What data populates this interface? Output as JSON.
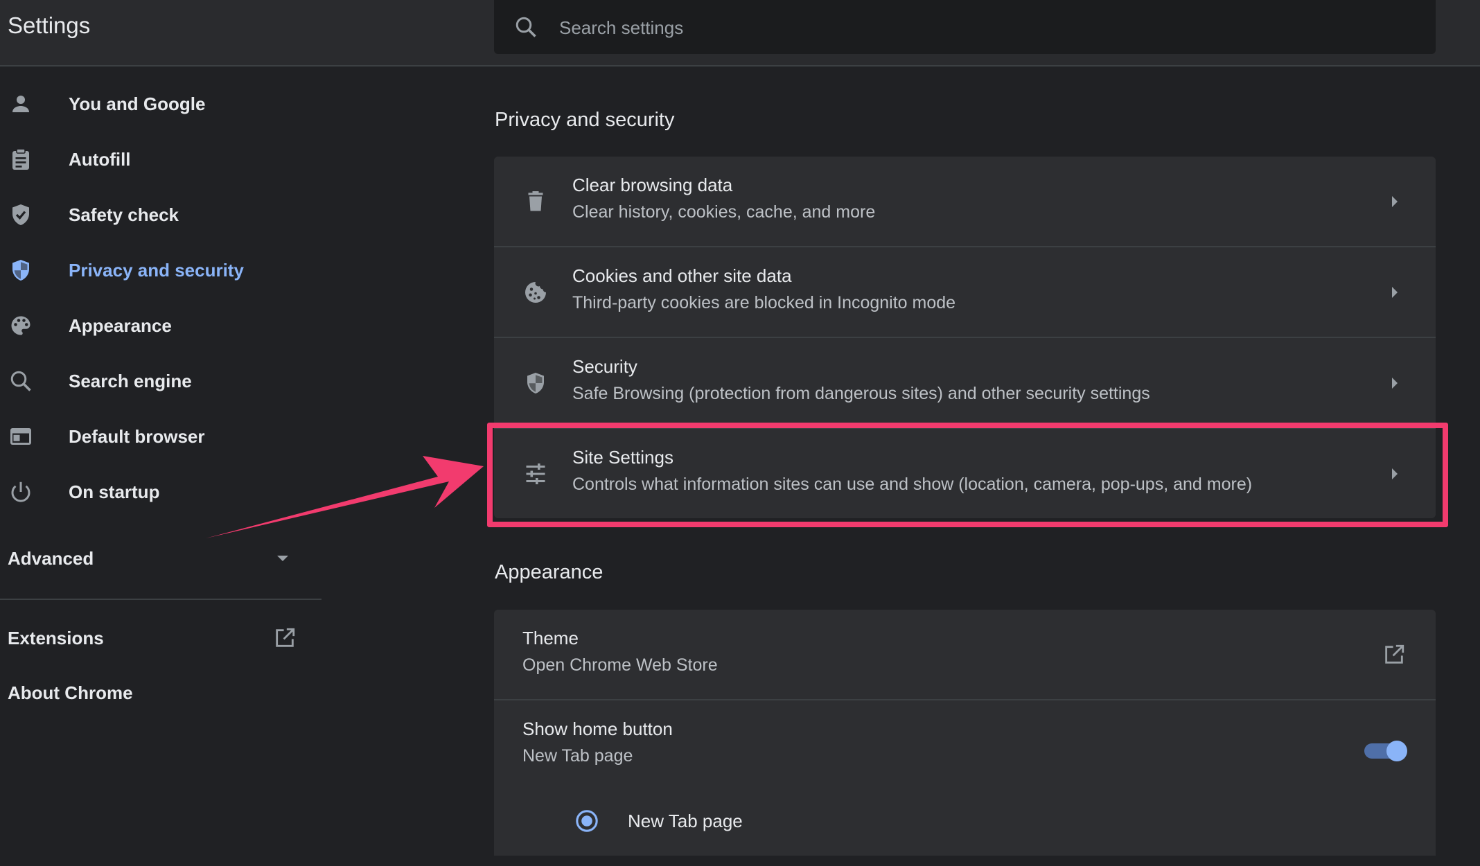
{
  "app": {
    "title": "Settings"
  },
  "search": {
    "placeholder": "Search settings"
  },
  "sidebar": {
    "items": [
      {
        "label": "You and Google",
        "icon": "person-icon"
      },
      {
        "label": "Autofill",
        "icon": "clipboard-icon"
      },
      {
        "label": "Safety check",
        "icon": "shield-check-icon"
      },
      {
        "label": "Privacy and security",
        "icon": "shield-icon",
        "active": true
      },
      {
        "label": "Appearance",
        "icon": "palette-icon"
      },
      {
        "label": "Search engine",
        "icon": "search-icon"
      },
      {
        "label": "Default browser",
        "icon": "browser-icon"
      },
      {
        "label": "On startup",
        "icon": "power-icon"
      }
    ],
    "advanced_label": "Advanced",
    "extensions_label": "Extensions",
    "about_label": "About Chrome"
  },
  "privacy": {
    "title": "Privacy and security",
    "rows": [
      {
        "title": "Clear browsing data",
        "subtitle": "Clear history, cookies, cache, and more",
        "icon": "trash-icon"
      },
      {
        "title": "Cookies and other site data",
        "subtitle": "Third-party cookies are blocked in Incognito mode",
        "icon": "cookie-icon"
      },
      {
        "title": "Security",
        "subtitle": "Safe Browsing (protection from dangerous sites) and other security settings",
        "icon": "security-shield-icon"
      },
      {
        "title": "Site Settings",
        "subtitle": "Controls what information sites can use and show (location, camera, pop-ups, and more)",
        "icon": "tune-icon"
      }
    ]
  },
  "appearance": {
    "title": "Appearance",
    "theme": {
      "title": "Theme",
      "subtitle": "Open Chrome Web Store"
    },
    "home_button": {
      "title": "Show home button",
      "subtitle": "New Tab page",
      "enabled": true
    },
    "radio_option": {
      "label": "New Tab page",
      "selected": true
    }
  },
  "colors": {
    "background": "#202124",
    "accent": "#8ab4f8",
    "highlight": "#f23b6e"
  }
}
